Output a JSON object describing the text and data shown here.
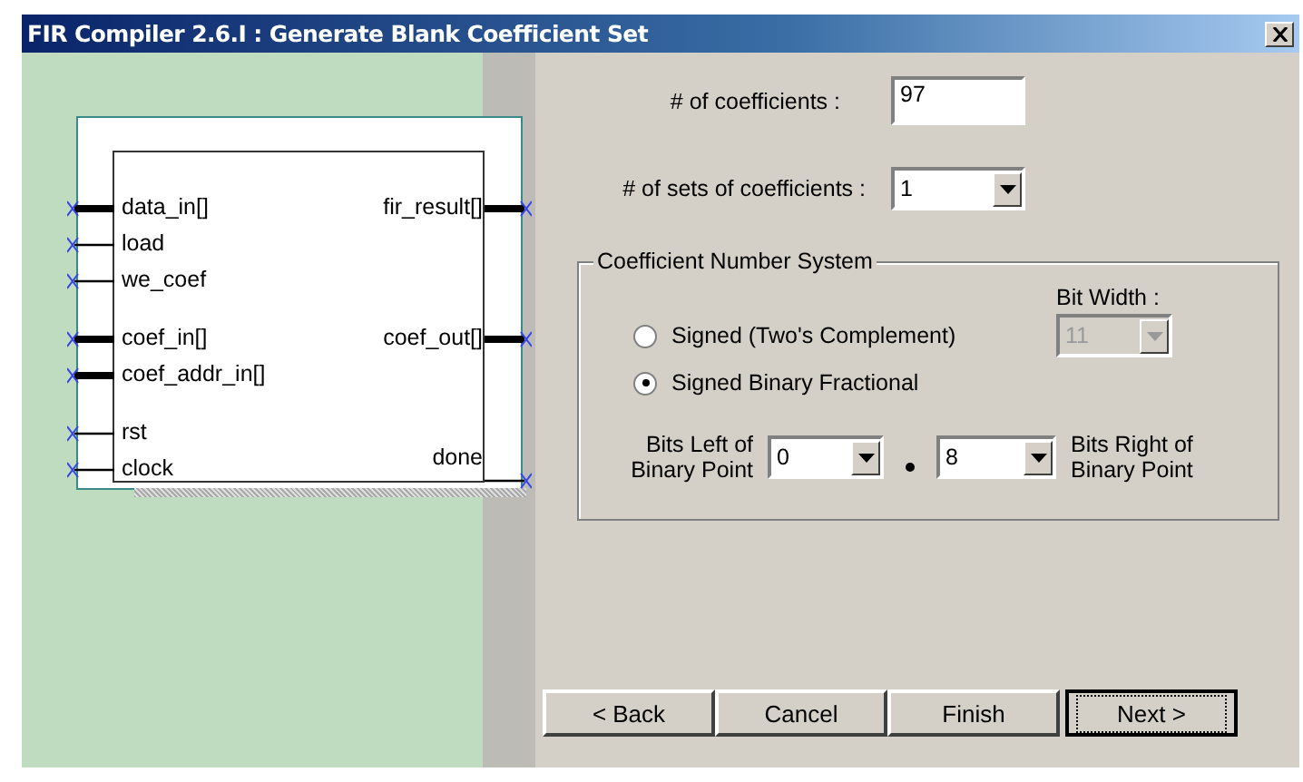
{
  "window": {
    "title": "FIR Compiler 2.6.I : Generate Blank Coefficient Set"
  },
  "diagram": {
    "groups": [
      [
        {
          "left": {
            "name": "data_in[]",
            "bus": true
          },
          "right": {
            "name": "fir_result[]",
            "bus": true
          }
        },
        {
          "left": {
            "name": "load",
            "bus": false
          }
        },
        {
          "left": {
            "name": "we_coef",
            "bus": false
          }
        }
      ],
      [
        {
          "left": {
            "name": "coef_in[]",
            "bus": true
          },
          "right": {
            "name": "coef_out[]",
            "bus": true
          }
        },
        {
          "left": {
            "name": "coef_addr_in[]",
            "bus": true
          }
        }
      ],
      [
        {
          "left": {
            "name": "rst",
            "bus": false
          }
        },
        {
          "left": {
            "name": "clock",
            "bus": false
          },
          "right": {
            "name": "done",
            "bus": false
          }
        }
      ]
    ]
  },
  "coefficients": {
    "label": "# of coefficients :",
    "value": "97"
  },
  "sets": {
    "label": "# of sets of coefficients :",
    "value": "1"
  },
  "number_system": {
    "title": "Coefficient Number System",
    "options": [
      {
        "label": "Signed (Two's Complement)",
        "selected": false
      },
      {
        "label": "Signed Binary Fractional",
        "selected": true
      }
    ],
    "bit_width": {
      "label": "Bit Width :",
      "value": "11",
      "disabled": true
    },
    "bits_left": {
      "label": "Bits Left of Binary Point",
      "value": "0"
    },
    "bits_right": {
      "label": "Bits Right of Binary Point",
      "value": "8"
    }
  },
  "buttons": [
    {
      "label": "< Back",
      "focused": false
    },
    {
      "label": "Cancel",
      "focused": false
    },
    {
      "label": "Finish",
      "focused": false
    },
    {
      "label": "Next >",
      "focused": true
    }
  ]
}
